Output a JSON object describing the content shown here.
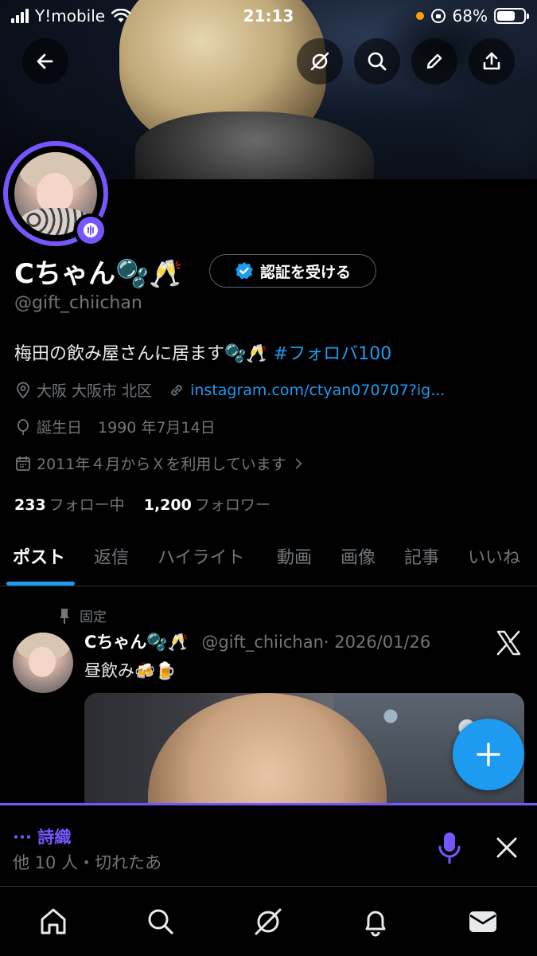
{
  "status_bar": {
    "carrier": "Y!mobile",
    "time": "21:13",
    "battery": "68%",
    "battery_level": 0.68
  },
  "header_icons": {
    "back": "back-arrow-icon",
    "grok": "grok-icon",
    "search": "search-icon",
    "edit": "pencil-icon",
    "share": "share-icon"
  },
  "profile": {
    "name": "Cちゃん🫧🥂",
    "verify_button": "認証を受ける",
    "handle": "@gift_chiichan",
    "bio_text": "梅田の飲み屋さんに居ます🫧🥂 ",
    "bio_hashtag": "#フォロバ100",
    "location": "大阪 大阪市 北区",
    "website": "instagram.com/ctyan070707?ig...",
    "birthday_label": "誕生日",
    "birthday": "1990 年7月14日",
    "joined": "2011年４月からＸを利用しています",
    "following_count": "233",
    "following_label": "フォロー中",
    "followers_count": "1,200",
    "followers_label": "フォロワー"
  },
  "tabs": [
    "ポスト",
    "返信",
    "ハイライト",
    "動画",
    "画像",
    "記事",
    "いいね"
  ],
  "pinned_post": {
    "pinned_label": "固定",
    "author_name": "Cちゃん🫧🥂",
    "author_handle": "@gift_chiichan",
    "date": "· 2026/01/26",
    "text": "昼飲み🍻🍺"
  },
  "space_bar": {
    "title": "··· 詩織",
    "subtitle": "他 10 人・切れたあ"
  },
  "colors": {
    "accent": "#1d9bf0",
    "spaces_purple": "#7856ff",
    "muted_text": "#71767b",
    "background": "#000000"
  },
  "bottom_nav": [
    "home-icon",
    "search-icon",
    "grok-icon",
    "notifications-icon",
    "messages-icon"
  ]
}
